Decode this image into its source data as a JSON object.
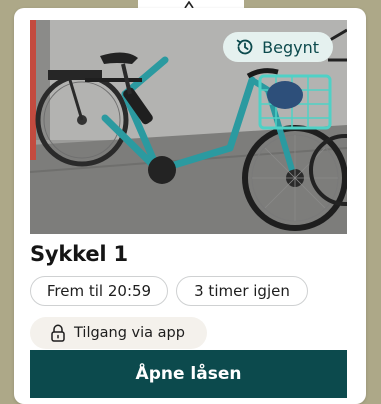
{
  "booking_card": {
    "photo_alt": "Turquoise electric bicycle with front basket",
    "status_chip": {
      "label": "Begynt",
      "icon": "history-icon"
    },
    "title": "Sykkel 1",
    "end_time_label": "Frem til 20:59",
    "remaining_label": "3 timer igjen",
    "access": {
      "label": "Tilgang via app",
      "icon": "lock-icon"
    },
    "primary_action": {
      "label": "Åpne låsen"
    }
  },
  "colors": {
    "background": "#ada888",
    "card": "#ffffff",
    "accent_dark_teal": "#0c4a4d",
    "status_chip_bg": "#e5f1ef",
    "access_chip_bg": "#f4f1ec",
    "pill_border": "#cfd1d2",
    "bike_frame": "#2b9aa0"
  }
}
